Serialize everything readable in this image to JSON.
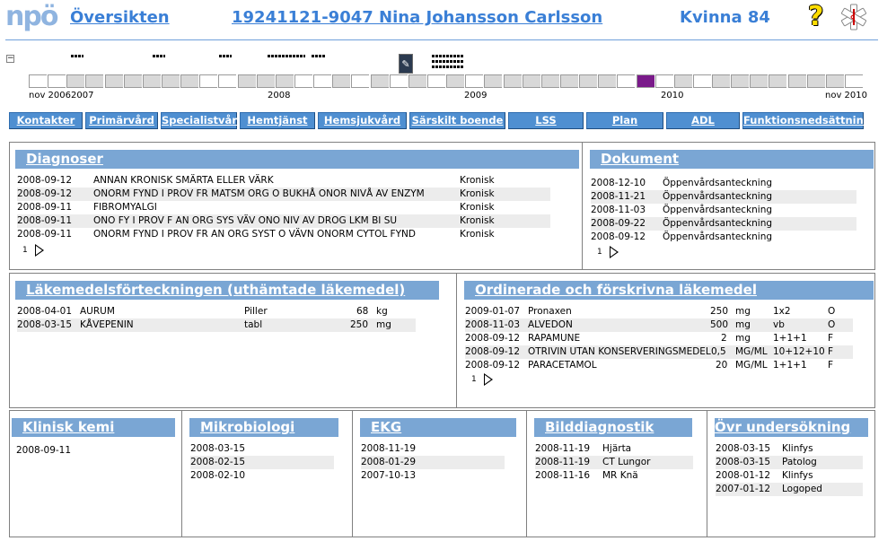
{
  "header": {
    "logo": "npö",
    "overview": "Översikten",
    "patient": "19241121-9047 Nina Johansson Carlsson",
    "sex_age": "Kvinna 84",
    "help": "?"
  },
  "timeline": {
    "collapse": "−",
    "labels": [
      "nov 2006",
      "2007",
      "2008",
      "2009",
      "2010",
      "nov 2010"
    ]
  },
  "nav": [
    "Kontakter",
    "Primärvård",
    "Specialistvård",
    "Hemtjänst",
    "Hemsjukvård",
    "Särskilt boende",
    "LSS",
    "Plan",
    "ADL",
    "Funktionsnedsättning"
  ],
  "diagnoser": {
    "title": "Diagnoser",
    "rows": [
      {
        "date": "2008-09-12",
        "text": "ANNAN KRONISK SMÄRTA ELLER VÄRK",
        "type": "Kronisk"
      },
      {
        "date": "2008-09-12",
        "text": "ONORM FYND I PROV FR MATSM ORG O BUKHÅ ONOR NIVÅ AV ENZYM",
        "type": "Kronisk"
      },
      {
        "date": "2008-09-11",
        "text": "FIBROMYALGI",
        "type": "Kronisk"
      },
      {
        "date": "2008-09-11",
        "text": "ONO FY I PROV F AN ORG SYS VÄV ONO NIV AV DROG LKM BI SU",
        "type": "Kronisk"
      },
      {
        "date": "2008-09-11",
        "text": "ONORM FYND I PROV FR AN ORG SYST O VÄVN ONORM CYTOL FYND",
        "type": "Kronisk"
      }
    ],
    "page": "1"
  },
  "dokument": {
    "title": "Dokument",
    "rows": [
      {
        "date": "2008-12-10",
        "text": "Öppenvårdsanteckning"
      },
      {
        "date": "2008-11-21",
        "text": "Öppenvårdsanteckning"
      },
      {
        "date": "2008-11-03",
        "text": "Öppenvårdsanteckning"
      },
      {
        "date": "2008-09-22",
        "text": "Öppenvårdsanteckning"
      },
      {
        "date": "2008-09-12",
        "text": "Öppenvårdsanteckning"
      }
    ],
    "page": "1"
  },
  "lakemedel": {
    "title": "Läkemedelsförteckningen (uthämtade läkemedel)",
    "rows": [
      {
        "date": "2008-04-01",
        "name": "AURUM",
        "form": "Piller",
        "qty": "68",
        "unit": "kg"
      },
      {
        "date": "2008-03-15",
        "name": "KÅVEPENIN",
        "form": "tabl",
        "qty": "250",
        "unit": "mg"
      }
    ]
  },
  "ordinerade": {
    "title": "Ordinerade och förskrivna läkemedel",
    "rows": [
      {
        "date": "2009-01-07",
        "name": "Pronaxen",
        "qty": "250",
        "unit": "mg",
        "dose": "1x2",
        "code": "O"
      },
      {
        "date": "2008-11-03",
        "name": "ALVEDON",
        "qty": "500",
        "unit": "mg",
        "dose": "vb",
        "code": "O"
      },
      {
        "date": "2008-09-12",
        "name": "RAPAMUNE",
        "qty": "2",
        "unit": "mg",
        "dose": "1+1+1",
        "code": "F"
      },
      {
        "date": "2008-09-12",
        "name": "OTRIVIN UTAN KONSERVERINGSMEDEL",
        "qty": "0,5",
        "unit": "MG/ML",
        "dose": "10+12+10",
        "code": "F"
      },
      {
        "date": "2008-09-12",
        "name": "PARACETAMOL",
        "qty": "20",
        "unit": "MG/ML",
        "dose": "1+1+1",
        "code": "F"
      }
    ],
    "page": "1"
  },
  "klinisk": {
    "title": "Klinisk kemi",
    "rows": [
      {
        "date": "2008-09-11"
      }
    ]
  },
  "mikro": {
    "title": "Mikrobiologi",
    "rows": [
      {
        "date": "2008-03-15"
      },
      {
        "date": "2008-02-15"
      },
      {
        "date": "2008-02-10"
      }
    ]
  },
  "ekg": {
    "title": "EKG",
    "rows": [
      {
        "date": "2008-11-19"
      },
      {
        "date": "2008-01-29"
      },
      {
        "date": "2007-10-13"
      }
    ]
  },
  "bild": {
    "title": "Bilddiagnostik",
    "rows": [
      {
        "date": "2008-11-19",
        "text": "Hjärta"
      },
      {
        "date": "2008-11-19",
        "text": "CT Lungor"
      },
      {
        "date": "2008-11-16",
        "text": "MR Knä"
      }
    ]
  },
  "ovr": {
    "title": "Övr undersökning",
    "rows": [
      {
        "date": "2008-03-15",
        "text": "Klinfys"
      },
      {
        "date": "2008-03-15",
        "text": "Patolog"
      },
      {
        "date": "2008-01-12",
        "text": "Klinfys"
      },
      {
        "date": "2007-01-12",
        "text": "Logoped"
      }
    ]
  },
  "colors": {
    "accent": "#3a7fd6",
    "title_bg": "#7aa6d4",
    "nav_bg": "#4f8fd1",
    "marker": "#7a1a8a"
  }
}
